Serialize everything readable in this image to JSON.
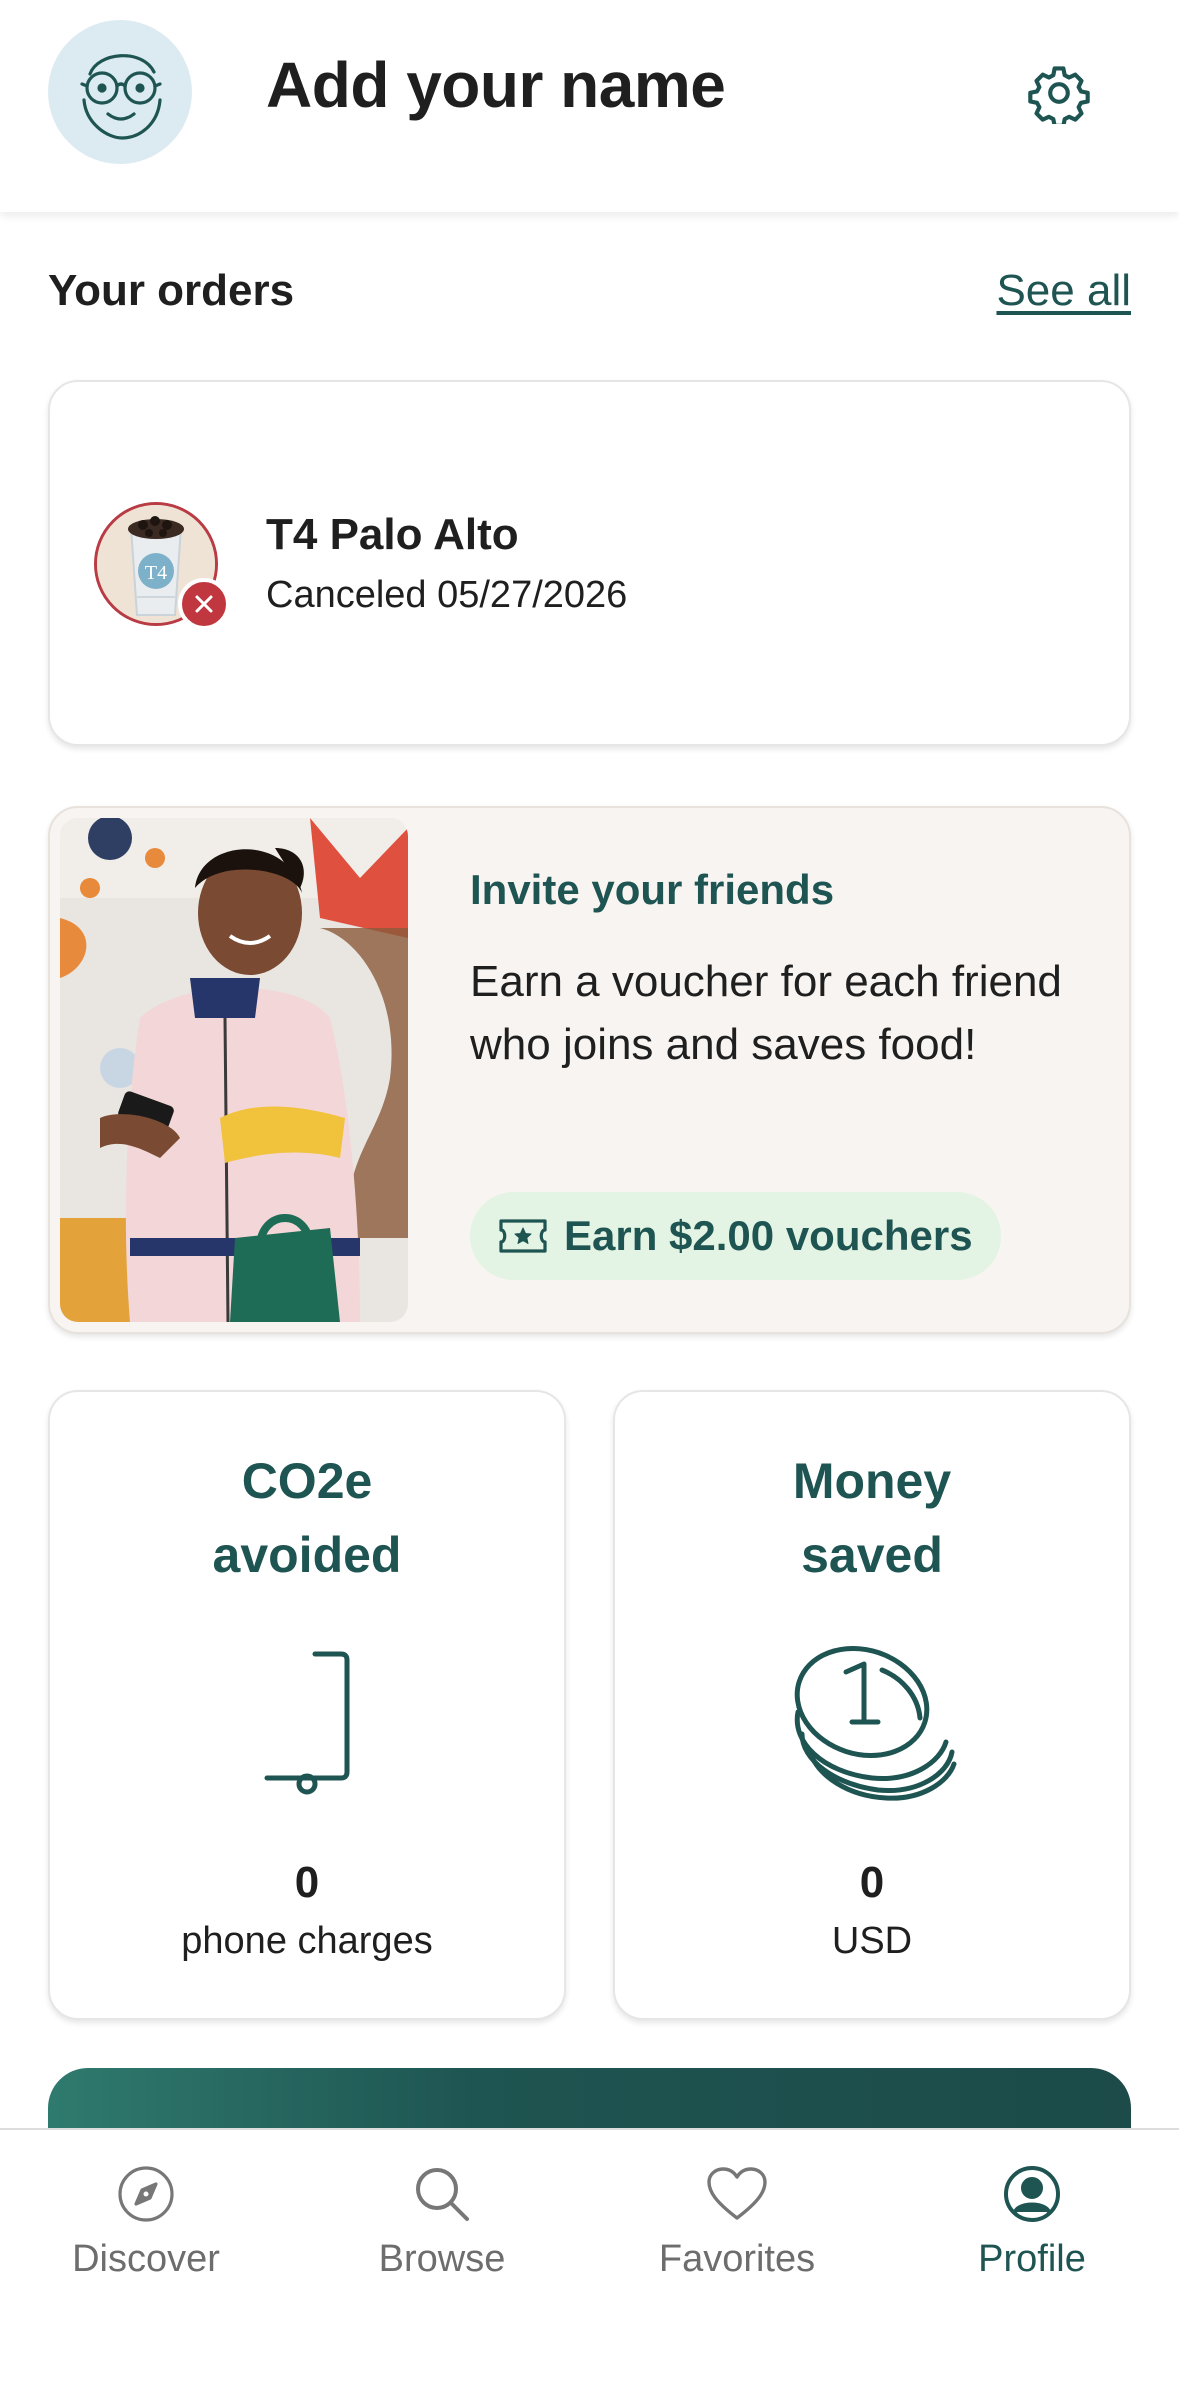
{
  "header": {
    "title": "Add your name",
    "avatar_icon": "smiling-face-with-glasses-icon",
    "settings_icon": "gear-icon"
  },
  "orders": {
    "section_title": "Your orders",
    "see_all_label": "See all",
    "items": [
      {
        "store_name": "T4 Palo Alto",
        "status": "Canceled 05/27/2026",
        "thumb_icon": "bubble-tea-cup-image",
        "badge_icon": "close-icon"
      }
    ]
  },
  "invite": {
    "title": "Invite your friends",
    "body": "Earn a voucher for each friend who joins and saves food!",
    "cta_label": "Earn $2.00 vouchers",
    "cta_icon": "voucher-ticket-icon",
    "photo": "woman-with-phone-and-tote-photo"
  },
  "stats": [
    {
      "title": "CO2e avoided",
      "value": "0",
      "unit": "phone charges",
      "icon": "phone-charge-icon"
    },
    {
      "title": "Money saved",
      "value": "0",
      "unit": "USD",
      "icon": "coin-stack-icon"
    }
  ],
  "tabbar": {
    "items": [
      {
        "label": "Discover",
        "icon": "compass-icon",
        "active": false
      },
      {
        "label": "Browse",
        "icon": "search-icon",
        "active": false
      },
      {
        "label": "Favorites",
        "icon": "heart-icon",
        "active": false
      },
      {
        "label": "Profile",
        "icon": "profile-icon",
        "active": true
      }
    ]
  },
  "colors": {
    "brand": "#1e5451",
    "cancel": "#c0373f",
    "pill_bg": "#e3f3e4",
    "invite_bg": "#f8f4f1",
    "avatar_bg": "#dcebf2"
  }
}
